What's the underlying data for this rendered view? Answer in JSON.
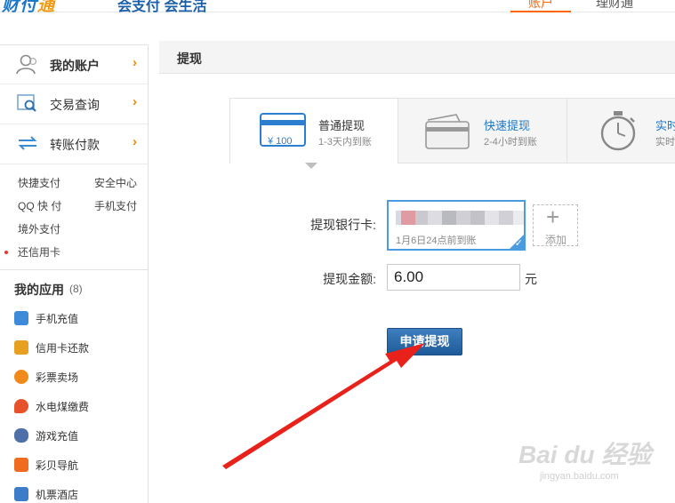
{
  "header": {
    "logo_text_blue": "财付",
    "logo_text_orange": "通",
    "slogan": "会支付 会生活",
    "tabs": [
      "账户",
      "理财通"
    ]
  },
  "sidebar": {
    "main_items": [
      {
        "label": "我的账户",
        "icon": "user-icon",
        "chevron": "›"
      },
      {
        "label": "交易查询",
        "icon": "search-doc-icon",
        "chevron": "›"
      },
      {
        "label": "转账付款",
        "icon": "transfer-icon",
        "chevron": "›"
      }
    ],
    "quick_links": [
      {
        "label": "快捷支付"
      },
      {
        "label": "安全中心"
      },
      {
        "label": "QQ 快 付"
      },
      {
        "label": "手机支付"
      },
      {
        "label": "境外支付"
      },
      {
        "label": "还信用卡"
      }
    ],
    "apps_title": "我的应用",
    "apps_count": "(8)",
    "apps": [
      {
        "label": "手机充值",
        "icon": "phone-recharge-icon",
        "color": "#3c8ad8"
      },
      {
        "label": "信用卡还款",
        "icon": "credit-card-icon",
        "color": "#e8a020"
      },
      {
        "label": "彩票卖场",
        "icon": "lottery-icon",
        "color": "#f08a1a"
      },
      {
        "label": "水电煤缴费",
        "icon": "flame-icon",
        "color": "#e8522a"
      },
      {
        "label": "游戏充值",
        "icon": "gamepad-icon",
        "color": "#4e6fa8"
      },
      {
        "label": "彩贝导航",
        "icon": "caibei-icon",
        "color": "#f06a20"
      },
      {
        "label": "机票酒店",
        "icon": "plane-icon",
        "color": "#3d7cc9"
      }
    ]
  },
  "main": {
    "section_title": "提现",
    "tabs": [
      {
        "name": "普通提现",
        "sub": "1-3天内到账",
        "icon": "card-100-icon",
        "icon_text": "¥ 100"
      },
      {
        "name": "快速提现",
        "sub": "2-4小时到账",
        "icon": "card-icon"
      },
      {
        "name": "实时",
        "sub": "实时",
        "icon": "stopwatch-icon"
      }
    ],
    "form": {
      "bank_label": "提现银行卡:",
      "bank_card_sub": "1月6日24点前到账",
      "add_label": "添加",
      "amount_label": "提现金额:",
      "amount_value": "6.00",
      "unit": "元",
      "submit": "申请提现"
    }
  },
  "watermark": {
    "main": "Bai du 经验",
    "sub": "jingyan.baidu.com"
  },
  "colors": {
    "accent_blue": "#1b77c9",
    "accent_orange": "#f08a00",
    "button_blue": "#2a6aab",
    "arrow_red": "#e8221b"
  }
}
